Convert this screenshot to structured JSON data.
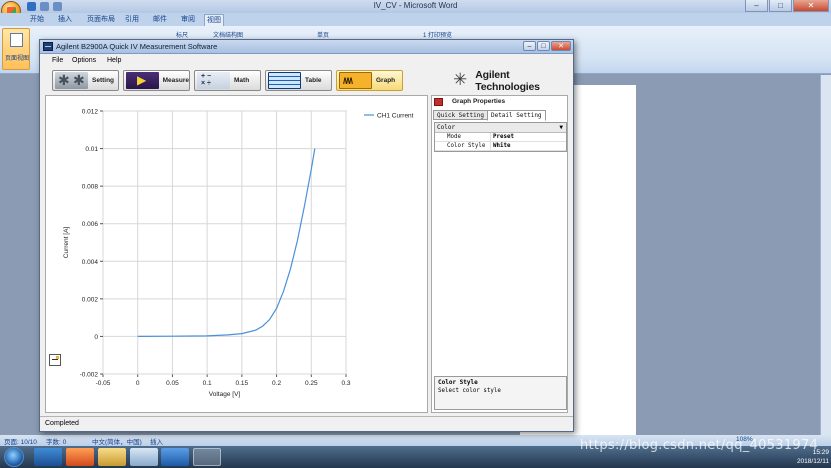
{
  "word": {
    "title": "IV_CV - Microsoft Word",
    "tabs": [
      "开始",
      "插入",
      "页面布局",
      "引用",
      "邮件",
      "审阅",
      "视图"
    ],
    "active_tab": "视图",
    "ribbon_big_label": "页面视图",
    "ribbon_items": [
      "标尺",
      "文档结构图",
      "单页",
      "1 打印预览"
    ],
    "status": {
      "page": "页面: 10/10",
      "words": "字数: 0",
      "language": "中文(简体，中国)",
      "mode": "插入",
      "zoom": "108%"
    }
  },
  "taskbar": {
    "time": "15:29",
    "date": "2018/12/11"
  },
  "watermark": "https://blog.csdn.net/qq_40531974",
  "app": {
    "title": "Agilent B2900A Quick IV Measurement Software",
    "menu": [
      "File",
      "Options",
      "Help"
    ],
    "toolbar": {
      "setting": "Setting",
      "measure": "Measure",
      "math": "Math",
      "table": "Table",
      "graph": "Graph"
    },
    "brand": "Agilent Technologies",
    "status": "Completed",
    "props": {
      "title": "Graph Properties",
      "tabs": [
        "Quick Setting",
        "Detail Setting"
      ],
      "selected_tab": "Detail Setting",
      "category": "Color",
      "rows": [
        {
          "key": "Mode",
          "value": "Preset"
        },
        {
          "key": "Color Style",
          "value": "White"
        }
      ],
      "desc_title": "Color Style",
      "desc_text": "Select color style"
    }
  },
  "chart_data": {
    "type": "line",
    "xlabel": "Voltage [V]",
    "ylabel": "Current [A]",
    "xlim": [
      -0.05,
      0.3
    ],
    "ylim": [
      -0.002,
      0.012
    ],
    "xticks": [
      -0.05,
      0,
      0.05,
      0.1,
      0.15,
      0.2,
      0.25,
      0.3
    ],
    "xtick_labels": [
      "-0.05",
      "0",
      "0.05",
      "0.1",
      "0.15",
      "0.2",
      "0.25",
      "0.3"
    ],
    "yticks": [
      -0.002,
      0,
      0.002,
      0.004,
      0.006,
      0.008,
      0.01,
      0.012
    ],
    "ytick_labels": [
      "-0.002",
      "0",
      "0.002",
      "0.004",
      "0.006",
      "0.008",
      "0.01",
      "0.012"
    ],
    "grid": true,
    "legend": "top-right",
    "series": [
      {
        "name": "CH1 Current",
        "color": "#4a90d9",
        "x": [
          0,
          0.05,
          0.1,
          0.13,
          0.15,
          0.17,
          0.18,
          0.19,
          0.2,
          0.21,
          0.22,
          0.23,
          0.24,
          0.25,
          0.255
        ],
        "y": [
          0,
          1e-05,
          3e-05,
          8e-05,
          0.00015,
          0.00033,
          0.00055,
          0.0009,
          0.0015,
          0.0024,
          0.0036,
          0.0051,
          0.0069,
          0.0089,
          0.01
        ]
      }
    ]
  }
}
